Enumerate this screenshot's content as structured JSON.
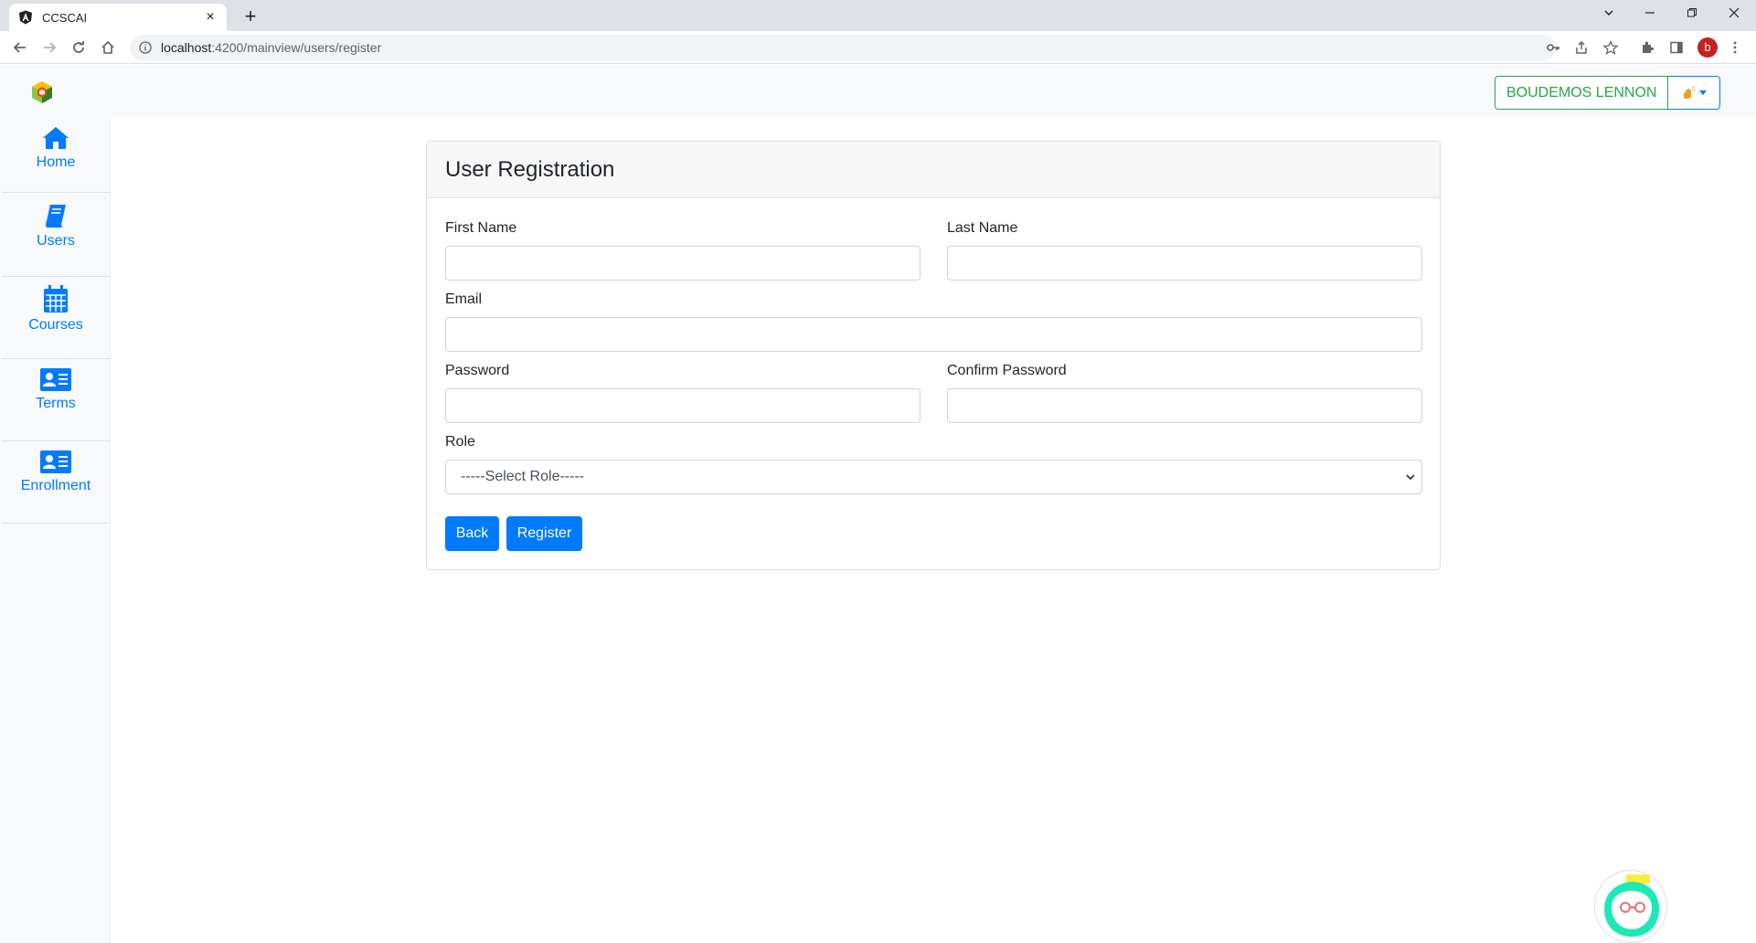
{
  "browser": {
    "tab_title": "CCSCAI",
    "url_host": "localhost",
    "url_path": ":4200/mainview/users/register",
    "profile_initial": "b"
  },
  "header": {
    "user_name": "BOUDEMOS LENNON"
  },
  "sidebar": {
    "items": [
      {
        "label": "Home",
        "icon": "home-icon"
      },
      {
        "label": "Users",
        "icon": "book-icon"
      },
      {
        "label": "Courses",
        "icon": "calendar-icon"
      },
      {
        "label": "Terms",
        "icon": "id-card-icon"
      },
      {
        "label": "Enrollment",
        "icon": "id-card-icon"
      }
    ]
  },
  "form": {
    "title": "User Registration",
    "first_name_label": "First Name",
    "last_name_label": "Last Name",
    "email_label": "Email",
    "password_label": "Password",
    "confirm_password_label": "Confirm Password",
    "role_label": "Role",
    "role_selected": "-----Select Role-----",
    "back_label": "Back",
    "register_label": "Register"
  },
  "colors": {
    "primary": "#007bff",
    "success": "#28a745",
    "sidebar_bg": "#f8f9fa"
  }
}
